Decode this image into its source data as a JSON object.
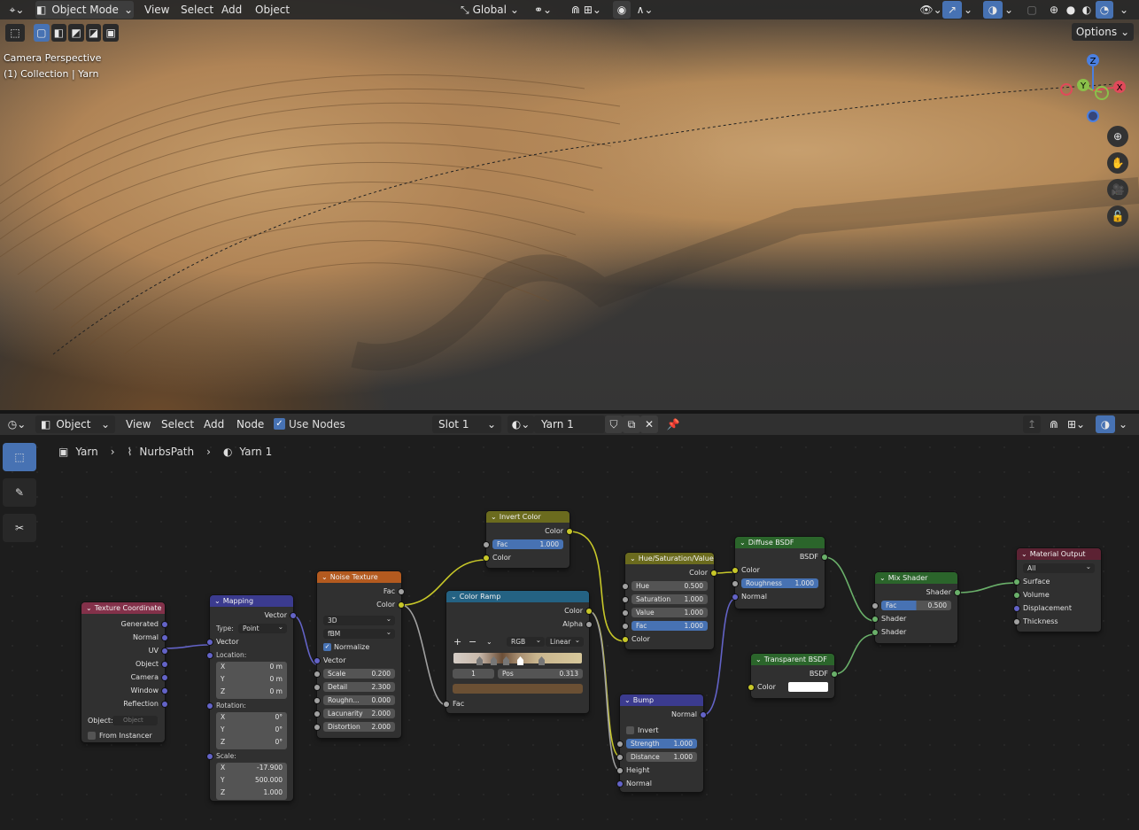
{
  "viewport": {
    "mode": "Object Mode",
    "menus": [
      "View",
      "Select",
      "Add",
      "Object"
    ],
    "orientation": "Global",
    "options": "Options",
    "overlay_title": "Camera Perspective",
    "overlay_sub": "(1) Collection | Yarn",
    "gizmo": {
      "z": "Z",
      "y": "Y",
      "x": "X"
    }
  },
  "node_editor": {
    "type": "Object",
    "menus": [
      "View",
      "Select",
      "Add",
      "Node"
    ],
    "use_nodes": "Use Nodes",
    "slot": "Slot 1",
    "material": "Yarn 1",
    "breadcrumb": [
      "Yarn",
      "NurbsPath",
      "Yarn 1"
    ]
  },
  "nodes": {
    "texcoord": {
      "title": "Texture Coordinate",
      "outputs": [
        "Generated",
        "Normal",
        "UV",
        "Object",
        "Camera",
        "Window",
        "Reflection"
      ],
      "object_label": "Object:",
      "object_placeholder": "Object",
      "from_instancer": "From Instancer"
    },
    "mapping": {
      "title": "Mapping",
      "out": "Vector",
      "type_label": "Type:",
      "type_value": "Point",
      "vector": "Vector",
      "location": "Location:",
      "loc": [
        [
          "X",
          "0 m"
        ],
        [
          "Y",
          "0 m"
        ],
        [
          "Z",
          "0 m"
        ]
      ],
      "rotation": "Rotation:",
      "rot": [
        [
          "X",
          "0°"
        ],
        [
          "Y",
          "0°"
        ],
        [
          "Z",
          "0°"
        ]
      ],
      "scale": "Scale:",
      "scl": [
        [
          "X",
          "-17.900"
        ],
        [
          "Y",
          "500.000"
        ],
        [
          "Z",
          "1.000"
        ]
      ]
    },
    "noise": {
      "title": "Noise Texture",
      "out_fac": "Fac",
      "out_color": "Color",
      "dim": "3D",
      "ntype": "fBM",
      "normalize": "Normalize",
      "vector": "Vector",
      "fields": [
        [
          "Scale",
          "0.200"
        ],
        [
          "Detail",
          "2.300"
        ],
        [
          "Roughn...",
          "0.000"
        ],
        [
          "Lacunarity",
          "2.000"
        ],
        [
          "Distortion",
          "2.000"
        ]
      ]
    },
    "invert": {
      "title": "Invert Color",
      "out": "Color",
      "fac_label": "Fac",
      "fac_value": "1.000",
      "in": "Color"
    },
    "ramp": {
      "title": "Color Ramp",
      "out_color": "Color",
      "out_alpha": "Alpha",
      "mode": "RGB",
      "interp": "Linear",
      "index": "1",
      "pos_label": "Pos",
      "pos_value": "0.313",
      "in": "Fac"
    },
    "hsv": {
      "title": "Hue/Saturation/Value",
      "out": "Color",
      "fields": [
        [
          "Hue",
          "0.500"
        ],
        [
          "Saturation",
          "1.000"
        ],
        [
          "Value",
          "1.000"
        ]
      ],
      "fac_label": "Fac",
      "fac_value": "1.000",
      "in": "Color"
    },
    "bump": {
      "title": "Bump",
      "out": "Normal",
      "invert": "Invert",
      "strength_label": "Strength",
      "strength_value": "1.000",
      "distance_label": "Distance",
      "distance_value": "1.000",
      "height": "Height",
      "normal": "Normal"
    },
    "diffuse": {
      "title": "Diffuse BSDF",
      "out": "BSDF",
      "color": "Color",
      "rough_label": "Roughness",
      "rough_value": "1.000",
      "normal": "Normal"
    },
    "transparent": {
      "title": "Transparent BSDF",
      "out": "BSDF",
      "color": "Color"
    },
    "mix": {
      "title": "Mix Shader",
      "out": "Shader",
      "fac_label": "Fac",
      "fac_value": "0.500",
      "in1": "Shader",
      "in2": "Shader"
    },
    "output": {
      "title": "Material Output",
      "target": "All",
      "inputs": [
        "Surface",
        "Volume",
        "Displacement",
        "Thickness"
      ]
    }
  },
  "colors": {
    "input_header": "#83314a",
    "vector_header": "#3b3b8f",
    "texture_header": "#b35a1f",
    "color_header": "#6b6b1e",
    "converter_header": "#246283",
    "shader_header": "#2b652b",
    "output_header": "#5c2233"
  }
}
